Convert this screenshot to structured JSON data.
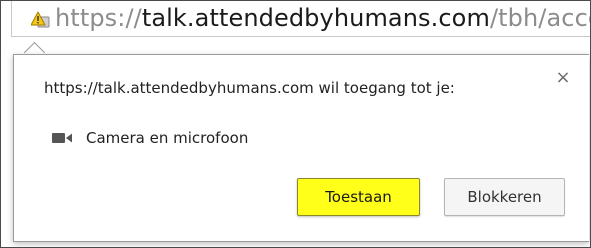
{
  "browser": {
    "url_scheme": "https://",
    "url_domain": "talk.attendedbyhumans.com",
    "url_path": "/tbh/accou",
    "security_icon": "warning-icon"
  },
  "permission_prompt": {
    "message": "https://talk.attendedbyhumans.com wil toegang tot je:",
    "close_icon": "close-icon",
    "close_glyph": "×",
    "permission_icon": "camera-icon",
    "permission_label": "Camera en microfoon",
    "allow_label": "Toestaan",
    "block_label": "Blokkeren"
  },
  "colors": {
    "allow_button": "#ffff1a",
    "url_scheme": "#8c8c8c",
    "url_domain": "#1a1a1a"
  }
}
